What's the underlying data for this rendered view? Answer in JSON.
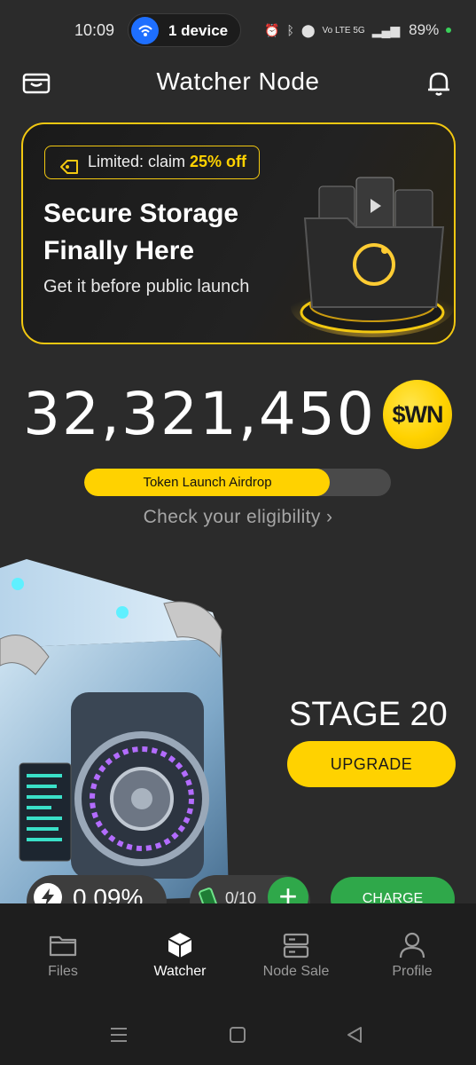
{
  "status_bar": {
    "time": "10:09",
    "device_label": "1 device",
    "network": "Vo LTE 5G",
    "battery_pct": "89%"
  },
  "header": {
    "title": "Watcher Node",
    "left_icon": "wallet-icon",
    "right_icon": "bell-icon"
  },
  "promo": {
    "badge_prefix": "Limited: claim ",
    "badge_highlight": "25% off",
    "title": "Secure Storage Finally Here",
    "subtitle": "Get it before public launch",
    "art_icon": "folder-storage-icon"
  },
  "balance": {
    "amount": "32,321,450",
    "token": "$WN"
  },
  "airdrop": {
    "label": "Token Launch Airdrop",
    "progress": 0.8,
    "link": "Check your eligibility ›"
  },
  "node": {
    "stage": "STAGE 20",
    "upgrade_label": "UPGRADE",
    "energy_value": "0.09%",
    "battery_count": "0/10",
    "add_label": "+",
    "charge_label": "CHARGE"
  },
  "bottom_nav": {
    "items": [
      {
        "label": "Files",
        "icon": "folder-icon"
      },
      {
        "label": "Watcher",
        "icon": "cube-icon"
      },
      {
        "label": "Node Sale",
        "icon": "server-icon"
      },
      {
        "label": "Profile",
        "icon": "person-icon"
      }
    ],
    "active_index": 1
  },
  "colors": {
    "accent": "#ffd200",
    "background": "#2b2b2b",
    "green": "#2fa84a"
  }
}
